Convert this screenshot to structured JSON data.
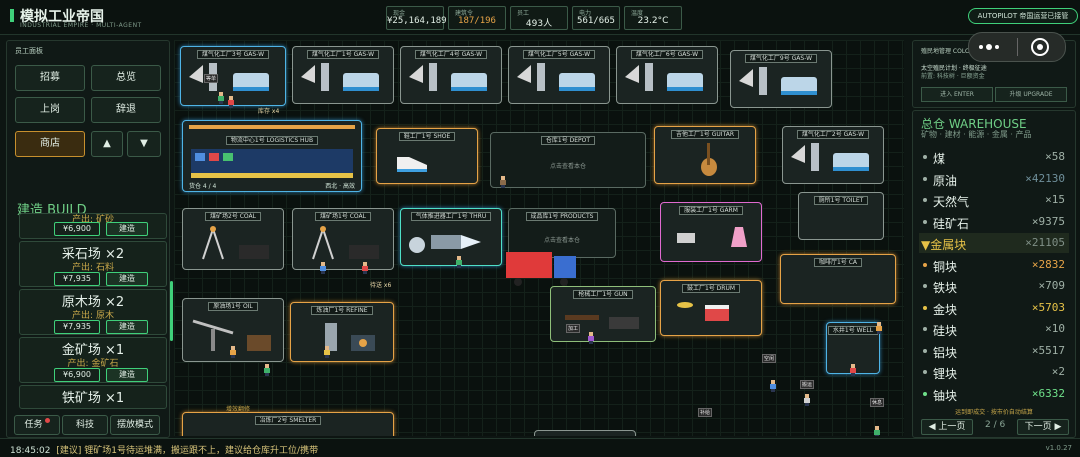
{
  "header": {
    "title": "模拟工业帝国",
    "subtitle": "INDUSTRIAL EMPIRE · MULTI-AGENT",
    "stats": [
      {
        "label": "现金",
        "value": "¥25,164,189",
        "color": "#e2efe6"
      },
      {
        "label": "建筑令",
        "value": "187/196",
        "color": "#e6a347"
      },
      {
        "label": "员工",
        "value": "493人",
        "color": "#e2efe6"
      },
      {
        "label": "电力",
        "value": "561/665",
        "color": "#e2efe6"
      },
      {
        "label": "温度",
        "value": "23.2°C",
        "color": "#e2efe6"
      }
    ],
    "autopilot": "AUTOPILOT 帝国运营已接管"
  },
  "left_panel": {
    "title": "员工面板",
    "buttons": [
      "招募",
      "总览",
      "上岗",
      "辞退",
      "商店"
    ],
    "arrow_up": "▲",
    "arrow_down": "▼",
    "build_title": "建造 BUILD",
    "cards": [
      {
        "name": "",
        "output": "产出: 矿砂",
        "price": "¥6,900",
        "build": "建造"
      },
      {
        "name": "采石场 ×2",
        "output": "产出: 石料",
        "price": "¥7,935",
        "build": "建造"
      },
      {
        "name": "原木场 ×2",
        "output": "产出: 原木",
        "price": "¥7,935",
        "build": "建造"
      },
      {
        "name": "金矿场 ×1",
        "output": "产出: 金矿石",
        "price": "¥6,900",
        "build": "建造"
      },
      {
        "name": "铁矿场 ×1",
        "output": "",
        "price": "",
        "build": ""
      }
    ],
    "bottom_buttons": [
      "任务",
      "科技",
      "摆放模式"
    ]
  },
  "map": {
    "buildings": [
      {
        "id": "gas1",
        "title": "煤气化工厂3号 GAS-W"
      },
      {
        "id": "gas2",
        "title": "煤气化工厂1号 GAS-W"
      },
      {
        "id": "gas3",
        "title": "煤气化工厂4号 GAS-W"
      },
      {
        "id": "gas4",
        "title": "煤气化工厂5号 GAS-W"
      },
      {
        "id": "gas5",
        "title": "煤气化工厂6号 GAS-W"
      },
      {
        "id": "gas6",
        "title": "煤气化工厂9号 GAS-W"
      },
      {
        "id": "hub",
        "title": "物流中心1号 LOGISTICS HUB",
        "foot_left": "货仓 4 / 4",
        "foot_right": "西北 · 高效"
      },
      {
        "id": "shoe",
        "title": "鞋工厂1号 SHOE"
      },
      {
        "id": "depot",
        "title": "仓库1号 DEPOT",
        "hint": "点击查看本仓"
      },
      {
        "id": "guitar",
        "title": "吉他工厂1号 GUITAR"
      },
      {
        "id": "gas7",
        "title": "煤气化工厂2号 GAS-W"
      },
      {
        "id": "coal2",
        "title": "煤矿场2号 COAL"
      },
      {
        "id": "coal1",
        "title": "煤矿场1号 COAL"
      },
      {
        "id": "thru",
        "title": "气体推进器工厂1号 THRU"
      },
      {
        "id": "products",
        "title": "成品库1号 PRODUCTS",
        "hint": "点击查看本仓"
      },
      {
        "id": "garm",
        "title": "服装工厂1号 GARM"
      },
      {
        "id": "toilet",
        "title": "厕所1号 TOILET"
      },
      {
        "id": "oil",
        "title": "原油场1号 OIL"
      },
      {
        "id": "refine",
        "title": "炼油厂1号 REFINE"
      },
      {
        "id": "gun",
        "title": "枪械工厂1号 GUN"
      },
      {
        "id": "drum",
        "title": "鼓工厂1号 DRUM"
      },
      {
        "id": "cafe",
        "title": "咖啡厅1号 CA"
      },
      {
        "id": "well",
        "title": "水井1号 WELL"
      },
      {
        "id": "smelter",
        "title": "冶炼厂2号 SMELTER"
      }
    ],
    "labels": {
      "stock_x4": "库存 x4",
      "wait_x6": "待送 x6",
      "upgrading": "增效翻修",
      "idle": "空闲",
      "haul": "搬运",
      "rest": "休息",
      "refill": "补给",
      "craft": "加工",
      "wait_order": "等单",
      "heal": "治疗",
      "thirst": "口渴"
    }
  },
  "colony": {
    "title": "殖民地管理 COLONY",
    "line1": "太空殖民计划 · 终极征途",
    "line2": "前置: 科技树 · 巨额资金",
    "enter": "进入 ENTER",
    "upgrade": "升级 UPGRADE"
  },
  "warehouse": {
    "title": "总仓 WAREHOUSE",
    "subtitle": "矿物 · 建材 · 能源 · 金属 · 产品",
    "items": [
      {
        "name": "煤",
        "qty": "×58",
        "qcolor": "#9fb0a6",
        "dot": "#9fb0a6"
      },
      {
        "name": "原油",
        "qty": "×42130",
        "qcolor": "#6f8f9a",
        "dot": "#9fb0a6"
      },
      {
        "name": "天然气",
        "qty": "×15",
        "qcolor": "#9fb0a6",
        "dot": "#9fb0a6"
      },
      {
        "name": "硅矿石",
        "qty": "×9375",
        "qcolor": "#9fb0a6",
        "dot": "#9fb0a6"
      },
      {
        "name": "▼金属块",
        "qty": "×21105",
        "qcolor": "#7f8f86",
        "dot": "",
        "header": true
      },
      {
        "name": "铜块",
        "qty": "×2832",
        "qcolor": "#e6a347",
        "dot": "#e6a347"
      },
      {
        "name": "铁块",
        "qty": "×709",
        "qcolor": "#9fb0a6",
        "dot": "#9fb0a6"
      },
      {
        "name": "金块",
        "qty": "×5703",
        "qcolor": "#e6c247",
        "dot": "#e6c247"
      },
      {
        "name": "硅块",
        "qty": "×10",
        "qcolor": "#9fb0a6",
        "dot": "#9fb0a6"
      },
      {
        "name": "铝块",
        "qty": "×5517",
        "qcolor": "#9fb0a6",
        "dot": "#9fb0a6"
      },
      {
        "name": "锂块",
        "qty": "×2",
        "qcolor": "#9fb0a6",
        "dot": "#9fb0a6"
      },
      {
        "name": "铀块",
        "qty": "×6332",
        "qcolor": "#6fe08a",
        "dot": "#6fe08a"
      }
    ],
    "note": "运到即成交 · 按市价自动结算",
    "prev": "◀ 上一页",
    "next": "下一页 ▶",
    "page": "2 / 6"
  },
  "footer": {
    "time": "18:45:02",
    "message": "[建议] 锂矿场1号待运堆满，搬运跟不上，建议给仓库升工位/携带",
    "version": "v1.0.27"
  }
}
